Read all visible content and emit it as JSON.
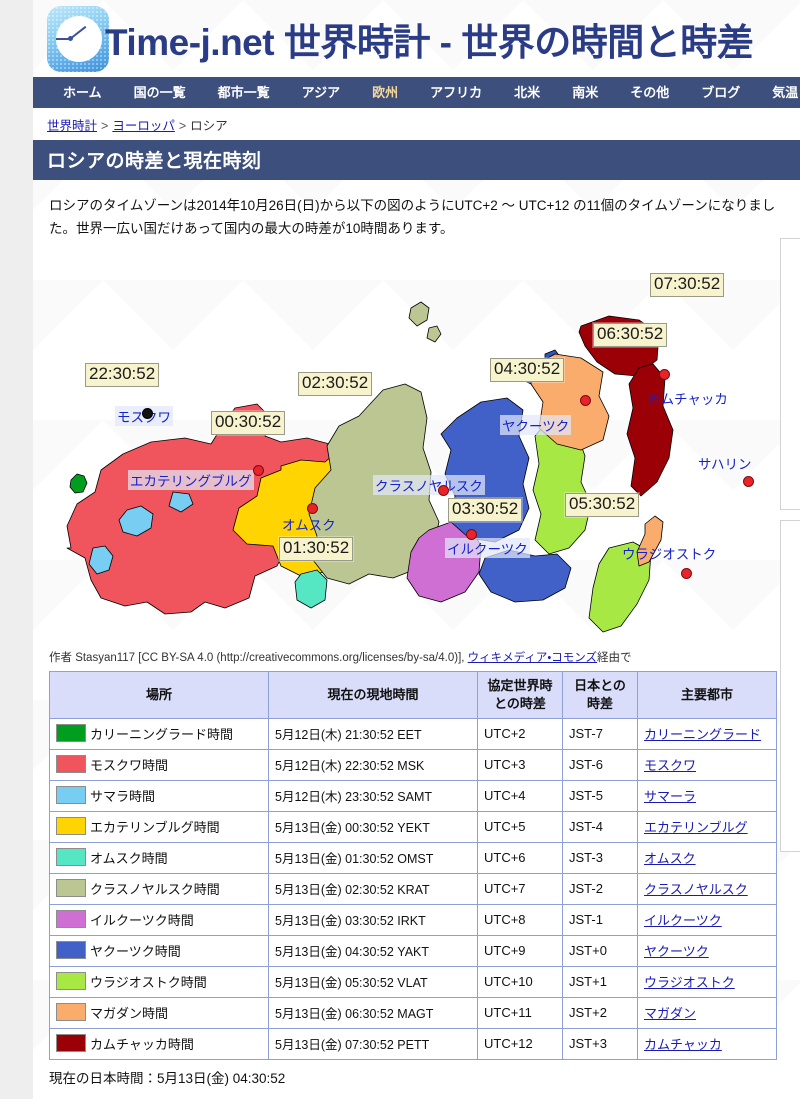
{
  "site": {
    "logo_name": "time-j-logo",
    "title": "Time-j.net 世界時計 - 世界の時間と時差"
  },
  "nav": {
    "items": [
      {
        "label": "ホーム",
        "current": false
      },
      {
        "label": "国の一覧",
        "current": false
      },
      {
        "label": "都市一覧",
        "current": false
      },
      {
        "label": "アジア",
        "current": false
      },
      {
        "label": "欧州",
        "current": true
      },
      {
        "label": "アフリカ",
        "current": false
      },
      {
        "label": "北米",
        "current": false
      },
      {
        "label": "南米",
        "current": false
      },
      {
        "label": "その他",
        "current": false
      },
      {
        "label": "ブログ",
        "current": false
      },
      {
        "label": "気温と雨量",
        "current": false
      }
    ]
  },
  "breadcrumb": {
    "home": "世界時計",
    "sep1": ">",
    "region": "ヨーロッパ",
    "sep2": ">",
    "current": "ロシア"
  },
  "page_title": "ロシアの時差と現在時刻",
  "intro": "ロシアのタイムゾーンは2014年10月26日(日)から以下の図のようにUTC+2 〜 UTC+12 の11個のタイムゾーンになりました。世界一広い国だけあって国内の最大の時差が10時間あります。",
  "map": {
    "caption_prefix": "作者 Stasyan117 [CC BY-SA 4.0 (http://creativecommons.org/licenses/by-sa/4.0)], ",
    "caption_link": "ウィキメディア・コモンズ",
    "caption_suffix": "経由で",
    "time_labels": [
      {
        "name": "moscow-time-label",
        "value": "22:30:52"
      },
      {
        "name": "yekaterinburg-time-label",
        "value": "00:30:52"
      },
      {
        "name": "omsk-time-label",
        "value": "01:30:52"
      },
      {
        "name": "krasnoyarsk-time-label",
        "value": "02:30:52"
      },
      {
        "name": "irkutsk-time-label",
        "value": "03:30:52"
      },
      {
        "name": "yakutsk-time-label",
        "value": "04:30:52"
      },
      {
        "name": "vladivostok-time-label",
        "value": "05:30:52"
      },
      {
        "name": "magadan-time-label",
        "value": "06:30:52"
      },
      {
        "name": "kamchatka-time-label",
        "value": "07:30:52"
      }
    ],
    "city_labels": [
      {
        "name": "moscow",
        "label": "モスクワ"
      },
      {
        "name": "yekaterinburg",
        "label": "エカテリングブルグ"
      },
      {
        "name": "omsk",
        "label": "オムスク"
      },
      {
        "name": "krasnoyarsk",
        "label": "クラスノヤルスク"
      },
      {
        "name": "irkutsk",
        "label": "イルクーツク"
      },
      {
        "name": "yakutsk",
        "label": "ヤクーツク"
      },
      {
        "name": "vladivostok",
        "label": "ウラジオストク"
      },
      {
        "name": "sakhalin",
        "label": "サハリン"
      },
      {
        "name": "kamchatka",
        "label": "カムチャッカ"
      }
    ],
    "zone_colors": {
      "kaliningrad": "#009e1e",
      "moscow": "#f0545c",
      "samara": "#77cdf2",
      "yekaterinburg": "#ffd400",
      "omsk": "#55e7c4",
      "krasnoyarsk": "#bcc693",
      "irkutsk": "#cf6fd3",
      "yakutsk": "#4161c9",
      "vladivostok": "#a7e845",
      "magadan": "#f9ac6b",
      "kamchatka": "#9b0007"
    }
  },
  "table": {
    "headers": [
      "場所",
      "現在の現地時間",
      "協定世界時との時差",
      "日本との時差",
      "主要都市"
    ],
    "header_utc_line1": "協定世界時",
    "header_utc_line2": "との時差",
    "header_jst_line1": "日本との",
    "header_jst_line2": "時差",
    "rows": [
      {
        "color": "#009e1e",
        "zone": "カリーニングラード時間",
        "local": "5月12日(木) 21:30:52  EET",
        "utc": "UTC+2",
        "jst": "JST-7",
        "city": "カリーニングラード"
      },
      {
        "color": "#f0545c",
        "zone": "モスクワ時間",
        "local": "5月12日(木) 22:30:52  MSK",
        "utc": "UTC+3",
        "jst": "JST-6",
        "city": "モスクワ"
      },
      {
        "color": "#77cdf2",
        "zone": "サマラ時間",
        "local": "5月12日(木) 23:30:52  SAMT",
        "utc": "UTC+4",
        "jst": "JST-5",
        "city": "サマーラ"
      },
      {
        "color": "#ffd400",
        "zone": "エカテリンブルグ時間",
        "local": "5月13日(金) 00:30:52  YEKT",
        "utc": "UTC+5",
        "jst": "JST-4",
        "city": "エカテリンブルグ"
      },
      {
        "color": "#55e7c4",
        "zone": "オムスク時間",
        "local": "5月13日(金) 01:30:52  OMST",
        "utc": "UTC+6",
        "jst": "JST-3",
        "city": "オムスク"
      },
      {
        "color": "#bcc693",
        "zone": "クラスノヤルスク時間",
        "local": "5月13日(金) 02:30:52  KRAT",
        "utc": "UTC+7",
        "jst": "JST-2",
        "city": "クラスノヤルスク"
      },
      {
        "color": "#cf6fd3",
        "zone": "イルクーツク時間",
        "local": "5月13日(金) 03:30:52  IRKT",
        "utc": "UTC+8",
        "jst": "JST-1",
        "city": "イルクーツク"
      },
      {
        "color": "#4161c9",
        "zone": "ヤクーツク時間",
        "local": "5月13日(金) 04:30:52  YAKT",
        "utc": "UTC+9",
        "jst": "JST+0",
        "city": "ヤクーツク"
      },
      {
        "color": "#a7e845",
        "zone": "ウラジオストク時間",
        "local": "5月13日(金) 05:30:52  VLAT",
        "utc": "UTC+10",
        "jst": "JST+1",
        "city": "ウラジオストク"
      },
      {
        "color": "#f9ac6b",
        "zone": "マガダン時間",
        "local": "5月13日(金) 06:30:52  MAGT",
        "utc": "UTC+11",
        "jst": "JST+2",
        "city": "マガダン"
      },
      {
        "color": "#9b0007",
        "zone": "カムチャッカ時間",
        "local": "5月13日(金) 07:30:52  PETT",
        "utc": "UTC+12",
        "jst": "JST+3",
        "city": "カムチャッカ"
      }
    ]
  },
  "footer_now": "現在の日本時間：5月13日(金) 04:30:52"
}
